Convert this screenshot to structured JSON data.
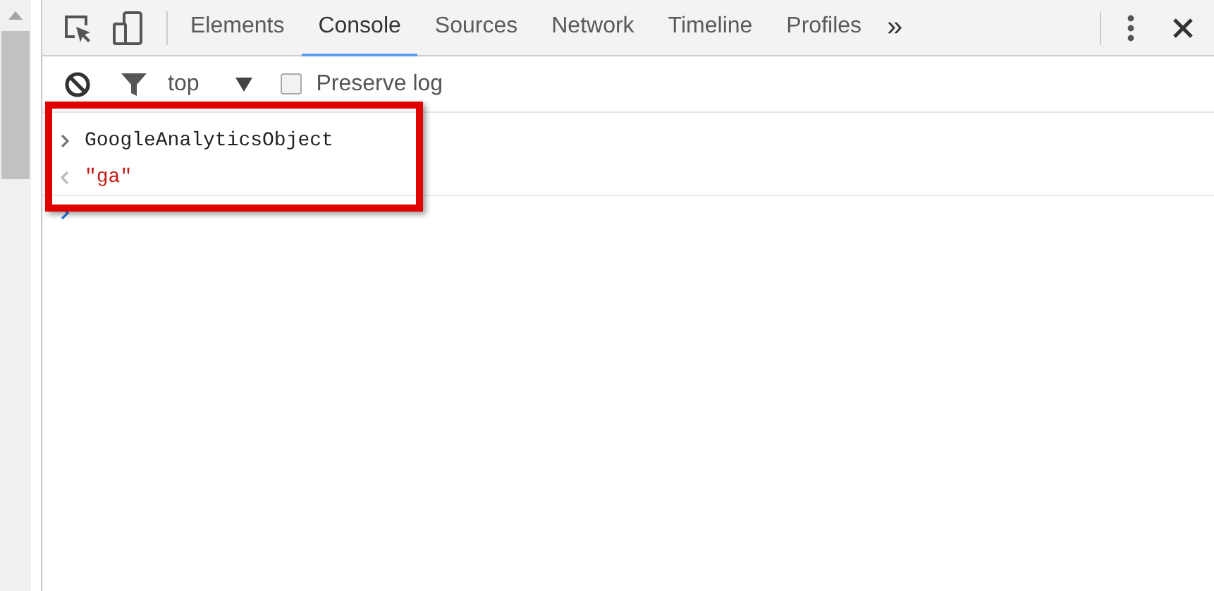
{
  "tabs": [
    {
      "label": "Elements",
      "selected": false
    },
    {
      "label": "Console",
      "selected": true
    },
    {
      "label": "Sources",
      "selected": false
    },
    {
      "label": "Network",
      "selected": false
    },
    {
      "label": "Timeline",
      "selected": false
    },
    {
      "label": "Profiles",
      "selected": false
    }
  ],
  "more_tabs": "»",
  "console_toolbar": {
    "context": "top",
    "preserve_log": {
      "label": "Preserve log",
      "checked": false
    }
  },
  "console": [
    {
      "kind": "input",
      "text": "GoogleAnalyticsObject"
    },
    {
      "kind": "output",
      "text": "\"ga\""
    },
    {
      "kind": "prompt"
    }
  ]
}
